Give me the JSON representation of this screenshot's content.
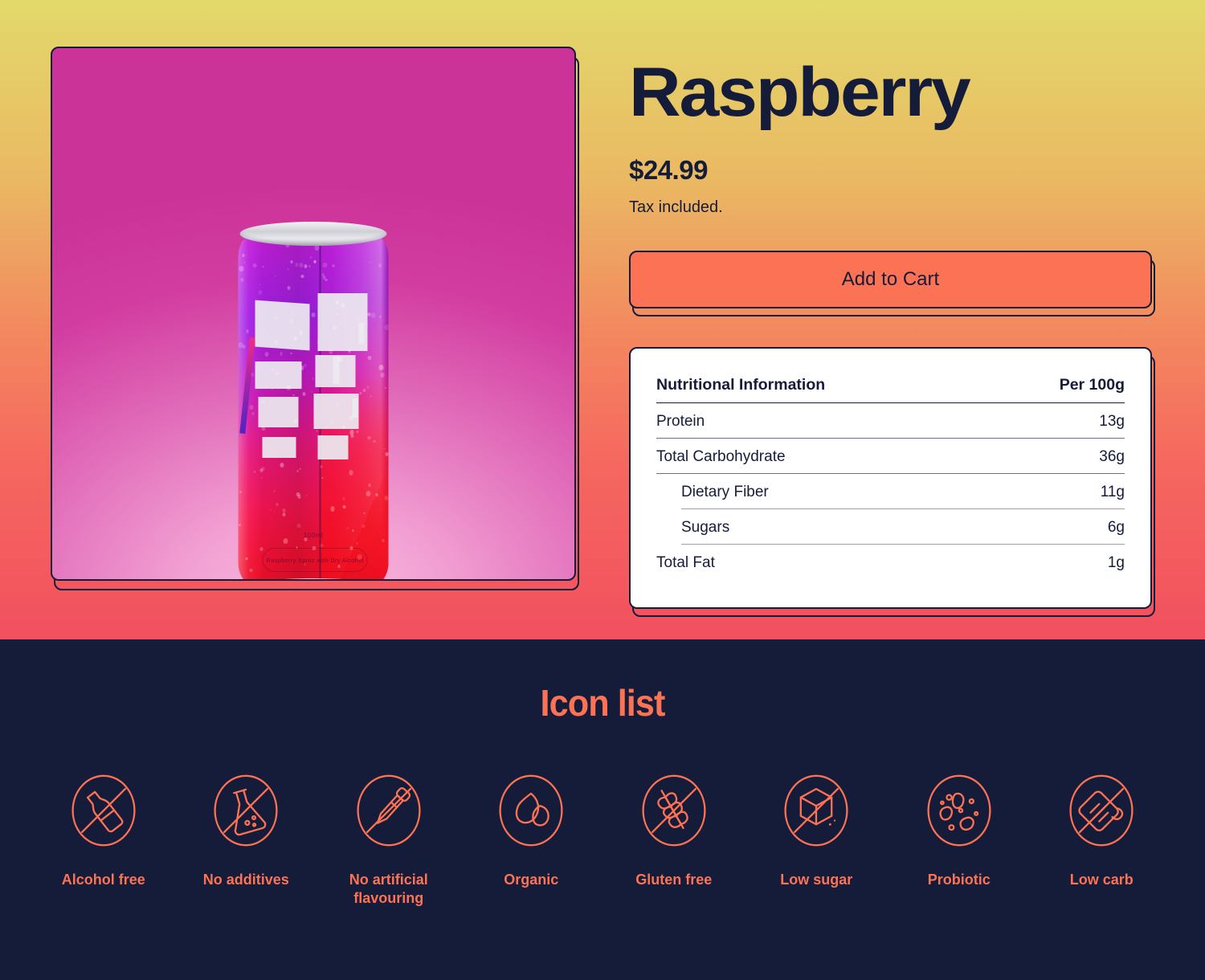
{
  "theme": {
    "navy": "#141c3a",
    "coral": "#fc7254",
    "gradient_top": "#e3d96b",
    "gradient_bottom": "#f2505f",
    "card_bg": "#ffffff",
    "image_bg_magenta": "#cc3399"
  },
  "product": {
    "title": "Raspberry",
    "price": "$24.99",
    "tax_note": "Tax included.",
    "add_to_cart_label": "Add to Cart",
    "image": {
      "alt": "Raspberry sparkling drink can",
      "can_volume_text": "100ml",
      "can_description_text": "Raspberry Spritz with Dry Alcohol"
    }
  },
  "nutrition": {
    "header": {
      "name": "Nutritional Information",
      "amount": "Per 100g"
    },
    "rows": [
      {
        "label": "Protein",
        "value": "13g",
        "indent": 0
      },
      {
        "label": "Total Carbohydrate",
        "value": "36g",
        "indent": 0
      },
      {
        "label": "Dietary Fiber",
        "value": "11g",
        "indent": 1
      },
      {
        "label": "Sugars",
        "value": "6g",
        "indent": 1
      },
      {
        "label": "Total Fat",
        "value": "1g",
        "indent": 0
      }
    ]
  },
  "icon_list": {
    "title": "Icon list",
    "items": [
      {
        "label": "Alcohol free",
        "icon": "no-alcohol-icon"
      },
      {
        "label": "No additives",
        "icon": "no-additives-flask-icon"
      },
      {
        "label": "No artificial flavouring",
        "icon": "no-artificial-flavouring-dropper-icon"
      },
      {
        "label": "Organic",
        "icon": "organic-leaves-icon"
      },
      {
        "label": "Gluten free",
        "icon": "gluten-free-wheat-icon"
      },
      {
        "label": "Low sugar",
        "icon": "low-sugar-cube-icon"
      },
      {
        "label": "Probiotic",
        "icon": "probiotic-bacteria-icon"
      },
      {
        "label": "Low carb",
        "icon": "low-carb-bread-icon"
      }
    ]
  }
}
